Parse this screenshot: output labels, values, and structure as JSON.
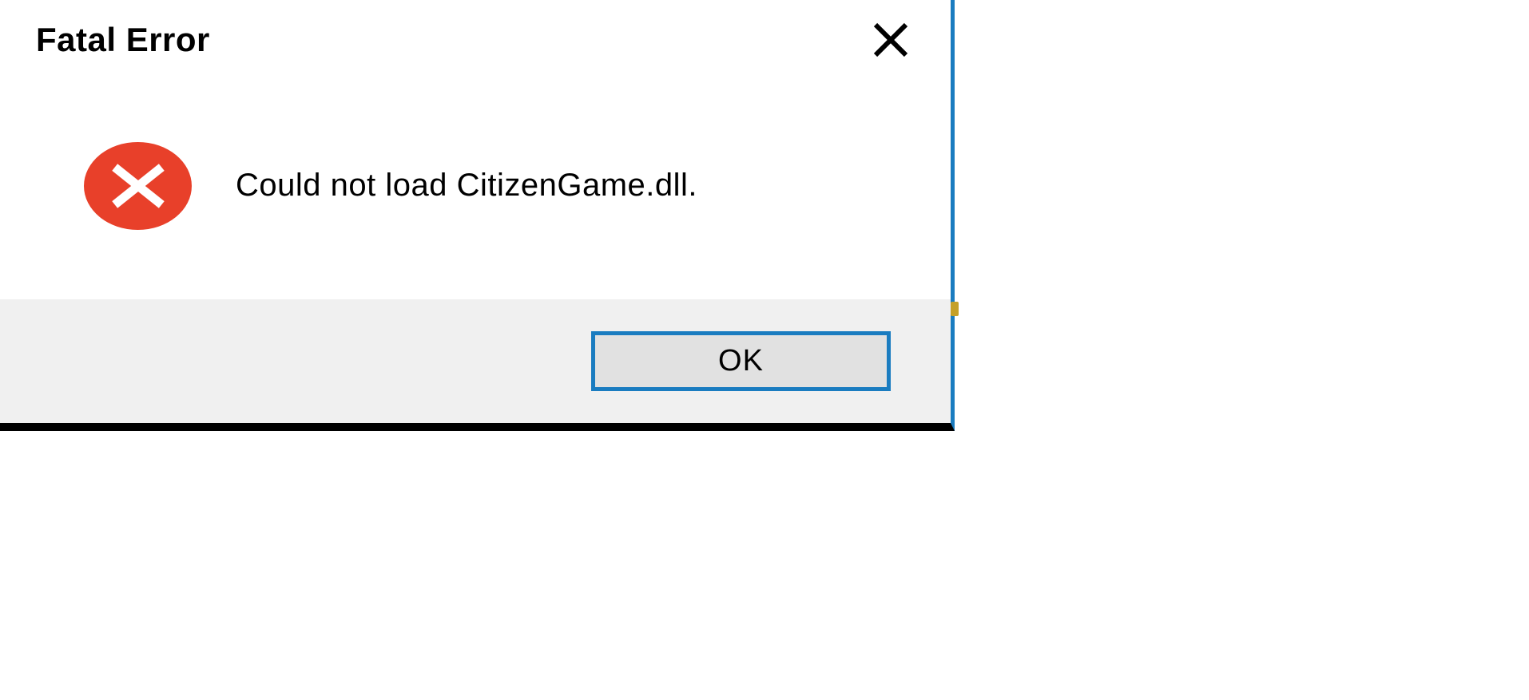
{
  "dialog": {
    "title": "Fatal Error",
    "message": "Could not load CitizenGame.dll.",
    "ok_label": "OK"
  }
}
